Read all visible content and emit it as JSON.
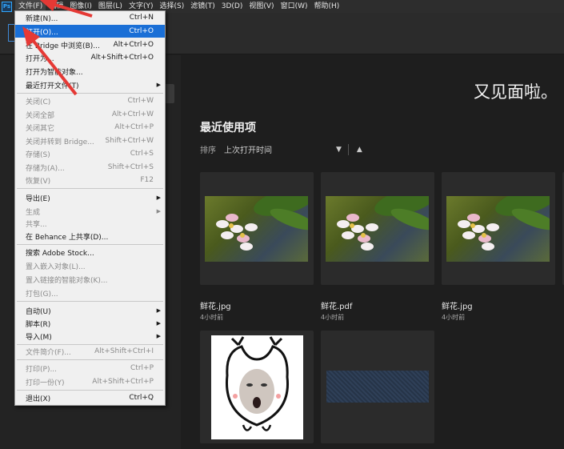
{
  "menubar": {
    "items": [
      "文件(F)",
      "编辑",
      "图像(I)",
      "图层(L)",
      "文字(Y)",
      "选择(S)",
      "滤镜(T)",
      "3D(D)",
      "视图(V)",
      "窗口(W)",
      "帮助(H)"
    ]
  },
  "main": {
    "welcome": "又见面啦。",
    "recent_title": "最近使用项",
    "sort_label": "排序",
    "sort_value": "上次打开时间",
    "files": [
      {
        "name": "鲜花.jpg",
        "time": "4小时前"
      },
      {
        "name": "鲜花.pdf",
        "time": "4小时前"
      },
      {
        "name": "鲜花.jpg",
        "time": "4小时前"
      }
    ]
  },
  "file_menu": {
    "items": [
      {
        "label": "新建(N)...",
        "shortcut": "Ctrl+N",
        "disabled": false,
        "submenu": false
      },
      {
        "label": "打开(O)...",
        "shortcut": "Ctrl+O",
        "disabled": false,
        "submenu": false,
        "highlight": true
      },
      {
        "label": "在 Bridge 中浏览(B)...",
        "shortcut": "Alt+Ctrl+O",
        "disabled": false,
        "submenu": false
      },
      {
        "label": "打开为...",
        "shortcut": "Alt+Shift+Ctrl+O",
        "disabled": false,
        "submenu": false
      },
      {
        "label": "打开为智能对象...",
        "shortcut": "",
        "disabled": false,
        "submenu": false
      },
      {
        "label": "最近打开文件(T)",
        "shortcut": "",
        "disabled": false,
        "submenu": true
      },
      {
        "label": "关闭(C)",
        "shortcut": "Ctrl+W",
        "disabled": true,
        "submenu": false
      },
      {
        "label": "关闭全部",
        "shortcut": "Alt+Ctrl+W",
        "disabled": true,
        "submenu": false
      },
      {
        "label": "关闭其它",
        "shortcut": "Alt+Ctrl+P",
        "disabled": true,
        "submenu": false
      },
      {
        "label": "关闭并转到 Bridge...",
        "shortcut": "Shift+Ctrl+W",
        "disabled": true,
        "submenu": false
      },
      {
        "label": "存储(S)",
        "shortcut": "Ctrl+S",
        "disabled": true,
        "submenu": false
      },
      {
        "label": "存储为(A)...",
        "shortcut": "Shift+Ctrl+S",
        "disabled": true,
        "submenu": false
      },
      {
        "label": "恢复(V)",
        "shortcut": "F12",
        "disabled": true,
        "submenu": false
      },
      {
        "label": "导出(E)",
        "shortcut": "",
        "disabled": false,
        "submenu": true
      },
      {
        "label": "生成",
        "shortcut": "",
        "disabled": true,
        "submenu": true
      },
      {
        "label": "共享...",
        "shortcut": "",
        "disabled": true,
        "submenu": false
      },
      {
        "label": "在 Behance 上共享(D)...",
        "shortcut": "",
        "disabled": false,
        "submenu": false
      },
      {
        "label": "搜索 Adobe Stock...",
        "shortcut": "",
        "disabled": false,
        "submenu": false
      },
      {
        "label": "置入嵌入对象(L)...",
        "shortcut": "",
        "disabled": true,
        "submenu": false
      },
      {
        "label": "置入链接的智能对象(K)...",
        "shortcut": "",
        "disabled": true,
        "submenu": false
      },
      {
        "label": "打包(G)...",
        "shortcut": "",
        "disabled": true,
        "submenu": false
      },
      {
        "label": "自动(U)",
        "shortcut": "",
        "disabled": false,
        "submenu": true
      },
      {
        "label": "脚本(R)",
        "shortcut": "",
        "disabled": false,
        "submenu": true
      },
      {
        "label": "导入(M)",
        "shortcut": "",
        "disabled": false,
        "submenu": true
      },
      {
        "label": "文件简介(F)...",
        "shortcut": "Alt+Shift+Ctrl+I",
        "disabled": true,
        "submenu": false
      },
      {
        "label": "打印(P)...",
        "shortcut": "Ctrl+P",
        "disabled": true,
        "submenu": false
      },
      {
        "label": "打印一份(Y)",
        "shortcut": "Alt+Shift+Ctrl+P",
        "disabled": true,
        "submenu": false
      },
      {
        "label": "退出(X)",
        "shortcut": "Ctrl+Q",
        "disabled": false,
        "submenu": false
      }
    ]
  },
  "colors": {
    "highlight": "#1a6fd6",
    "annotation_arrow": "#e53935"
  }
}
